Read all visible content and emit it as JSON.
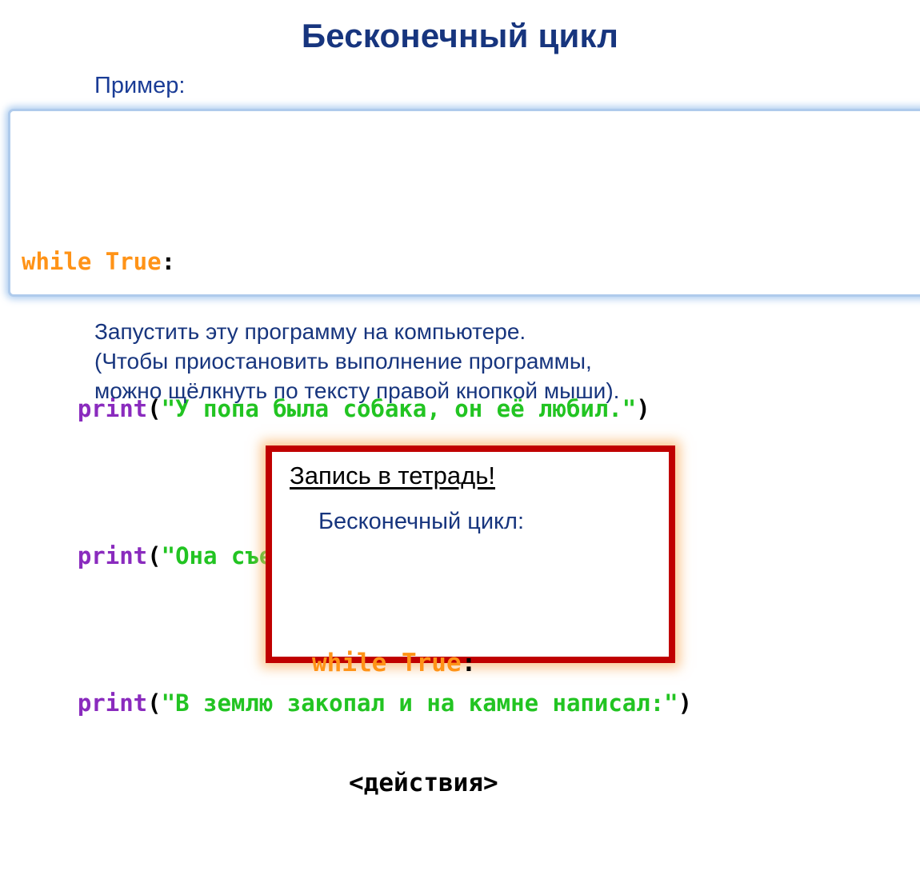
{
  "slide": {
    "title": "Бесконечный цикл",
    "example_label": "Пример:"
  },
  "code_panel": {
    "lines": [
      {
        "keyword": "while True",
        "colon": ":"
      },
      {
        "fn": "print",
        "open": "(",
        "string": "\"У попа была собака, он её любил.\"",
        "close": ")"
      },
      {
        "fn": "print",
        "open": "(",
        "string": "\"Она съела кусок мяса, он её убил,\"",
        "close": ")"
      },
      {
        "fn": "print",
        "open": "(",
        "string": "\"В землю закопал и на камне написал:\"",
        "close": ")"
      }
    ],
    "indent": "    "
  },
  "body": {
    "line1": "Запустить эту программу на компьютере.",
    "line2": "(Чтобы приостановить выполнение программы,",
    "line3": "можно щёлкнуть по тексту правой кнопкой мыши)."
  },
  "notebook": {
    "heading": "Запись в тетрадь!",
    "subtitle": "Бесконечный цикл:",
    "code_keyword": "while True",
    "code_colon": ":",
    "code_action": "<действия>"
  },
  "colors": {
    "navy": "#17357E",
    "keyword_orange": "#FF9317",
    "function_purple": "#8A2BBE",
    "string_green": "#22C422",
    "box_red": "#C00000",
    "panel_border_blue": "#AFCBEC"
  }
}
